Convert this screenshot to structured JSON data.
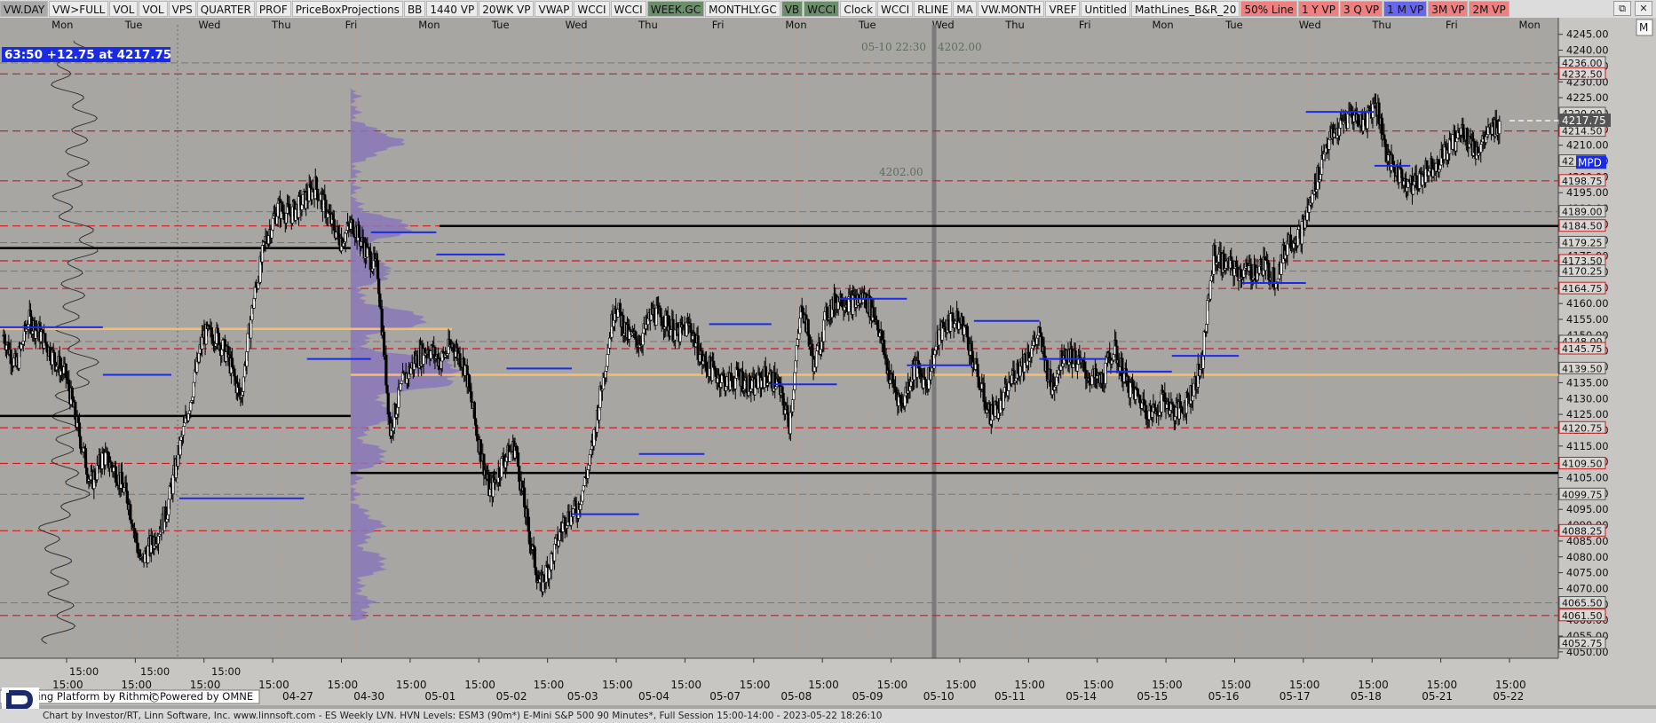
{
  "toolbar": {
    "items": [
      {
        "label": "VW.DAY",
        "bg": "#a9a9a9"
      },
      {
        "label": "VW>FULL",
        "bg": "#ececec"
      },
      {
        "label": "VOL",
        "bg": "#ececec"
      },
      {
        "label": "VOL",
        "bg": "#ececec"
      },
      {
        "label": "VPS",
        "bg": "#ececec"
      },
      {
        "label": "QUARTER",
        "bg": "#ececec"
      },
      {
        "label": "PROF",
        "bg": "#ececec"
      },
      {
        "label": "PriceBoxProjections",
        "bg": "#ececec"
      },
      {
        "label": "BB",
        "bg": "#ececec"
      },
      {
        "label": "1440 VP",
        "bg": "#ececec"
      },
      {
        "label": "20WK VP",
        "bg": "#ececec"
      },
      {
        "label": "VWAP",
        "bg": "#ececec"
      },
      {
        "label": "WCCI",
        "bg": "#ececec"
      },
      {
        "label": "WCCI",
        "bg": "#ececec"
      },
      {
        "label": "WEEK.GC",
        "bg": "#6a8f6a"
      },
      {
        "label": "MONTHLY.GC",
        "bg": "#ececec"
      },
      {
        "label": "VB",
        "bg": "#6a8f6a"
      },
      {
        "label": "WCCI",
        "bg": "#6a8f6a"
      },
      {
        "label": "Clock",
        "bg": "#ececec"
      },
      {
        "label": "WCCI",
        "bg": "#ececec"
      },
      {
        "label": "RLINE",
        "bg": "#ececec"
      },
      {
        "label": "MA",
        "bg": "#ececec"
      },
      {
        "label": "VW.MONTH",
        "bg": "#ececec"
      },
      {
        "label": "VREF",
        "bg": "#ececec"
      },
      {
        "label": "Untitled",
        "bg": "#ececec"
      },
      {
        "label": "MathLines_B&R_20",
        "bg": "#ececec"
      },
      {
        "label": "50% Line",
        "bg": "#f08080"
      },
      {
        "label": "1 Y VP",
        "bg": "#f08080"
      },
      {
        "label": "3 Q VP",
        "bg": "#f08080"
      },
      {
        "label": "1 M VP",
        "bg": "#6666ee"
      },
      {
        "label": "3M VP",
        "bg": "#f08080"
      },
      {
        "label": "2M VP",
        "bg": "#f08080"
      }
    ],
    "window_controls": [
      "⧉",
      "✕"
    ],
    "corner_label": "M"
  },
  "chart_data": {
    "type": "candlestick",
    "ylim": [
      4048,
      4248
    ],
    "yticks": [
      4050,
      4055,
      4060,
      4065,
      4070,
      4075,
      4080,
      4085,
      4090,
      4095,
      4100,
      4105,
      4110,
      4115,
      4120,
      4125,
      4130,
      4135,
      4140,
      4145,
      4150,
      4155,
      4160,
      4165,
      4170,
      4175,
      4180,
      4185,
      4190,
      4195,
      4200,
      4205,
      4210,
      4215,
      4220,
      4225,
      4230,
      4235,
      4240,
      4245
    ],
    "top_day_labels": [
      "Mon",
      "Tue",
      "Wed",
      "Thu",
      "Fri",
      "Mon",
      "Tue",
      "Wed",
      "Thu",
      "Fri",
      "Mon",
      "Tue",
      "Wed",
      "Thu",
      "Fri",
      "Mon",
      "Tue",
      "Wed",
      "Thu",
      "Fri",
      "Mon"
    ],
    "bottom_time_labels": [
      "15:00",
      "15:00",
      "15:00",
      "15:00",
      "15:00",
      "15:00",
      "15:00",
      "15:00",
      "15:00",
      "15:00",
      "15:00",
      "15:00",
      "15:00",
      "15:00",
      "15:00",
      "15:00",
      "15:00",
      "15:00",
      "15:00",
      "15:00",
      "15:00",
      "15:00"
    ],
    "bottom_date_labels": [
      "",
      "",
      "",
      "04-27",
      "04-30",
      "05-01",
      "05-02",
      "05-03",
      "05-04",
      "05-07",
      "05-08",
      "05-09",
      "05-10",
      "05-11",
      "05-14",
      "05-15",
      "05-16",
      "05-17",
      "05-18",
      "05-21",
      "05-22"
    ],
    "lower_time_labels": [
      "15:00",
      "15:00",
      "15:00"
    ],
    "info_badge": "63:50  +12.75 at 4217.75",
    "cursor_readout": {
      "datetime": "05-10 22:30",
      "price": "4202.00"
    },
    "level_label": "4202.00",
    "current_price": "4217.75",
    "mpd_label": "MPD",
    "price_labels": [
      "4236.00",
      "4232.50",
      "4220.00",
      "4214.50",
      "42",
      "4198.75",
      "4189.00",
      "4184.50",
      "4179.25",
      "4173.50",
      "4170.25",
      "4164.75",
      "4148.00",
      "4145.75",
      "4139.50",
      "4120.75",
      "4109.50",
      "4099.75",
      "4088.25",
      "4065.50",
      "4061.50",
      "4052.75"
    ],
    "red_dashed_levels": [
      4232.5,
      4214.5,
      4198.75,
      4184.5,
      4173.5,
      4164.75,
      4145.75,
      4120.75,
      4109.5,
      4088.25,
      4061.5
    ],
    "gray_dashed_levels": [
      4236,
      4189,
      4179.25,
      4170.25,
      4148,
      4099.75,
      4065.5
    ],
    "black_levels": [
      {
        "y": 4184.5,
        "from": 0.282,
        "to": 1.0
      },
      {
        "y": 4177.5,
        "from": 0.0,
        "to": 0.225
      },
      {
        "y": 4124.5,
        "from": 0.0,
        "to": 0.225
      },
      {
        "y": 4106.5,
        "from": 0.225,
        "to": 1.0
      }
    ],
    "orange_levels": [
      {
        "y": 4152,
        "from": 0.0,
        "to": 0.29
      },
      {
        "y": 4137.5,
        "from": 0.225,
        "to": 1.0
      }
    ],
    "blue_segments": [
      {
        "y": 4152.5,
        "from": 0.0,
        "to": 0.066
      },
      {
        "y": 4137.5,
        "from": 0.066,
        "to": 0.11
      },
      {
        "y": 4098.5,
        "from": 0.115,
        "to": 0.195
      },
      {
        "y": 4142.5,
        "from": 0.197,
        "to": 0.238
      },
      {
        "y": 4182.5,
        "from": 0.238,
        "to": 0.28
      },
      {
        "y": 4175.5,
        "from": 0.28,
        "to": 0.324
      },
      {
        "y": 4139.5,
        "from": 0.325,
        "to": 0.367
      },
      {
        "y": 4093.5,
        "from": 0.367,
        "to": 0.41
      },
      {
        "y": 4112.5,
        "from": 0.41,
        "to": 0.452
      },
      {
        "y": 4153.5,
        "from": 0.455,
        "to": 0.495
      },
      {
        "y": 4134.5,
        "from": 0.495,
        "to": 0.537
      },
      {
        "y": 4161.5,
        "from": 0.539,
        "to": 0.582
      },
      {
        "y": 4140.5,
        "from": 0.582,
        "to": 0.624
      },
      {
        "y": 4154.5,
        "from": 0.625,
        "to": 0.667
      },
      {
        "y": 4142.5,
        "from": 0.667,
        "to": 0.71
      },
      {
        "y": 4138.5,
        "from": 0.71,
        "to": 0.752
      },
      {
        "y": 4143.5,
        "from": 0.752,
        "to": 0.795
      },
      {
        "y": 4166.5,
        "from": 0.797,
        "to": 0.838
      },
      {
        "y": 4220.5,
        "from": 0.838,
        "to": 0.882
      },
      {
        "y": 4203.5,
        "from": 0.882,
        "to": 0.905
      }
    ],
    "candles": {
      "anchors": [
        4150,
        4140,
        4155,
        4150,
        4143,
        4137,
        4120,
        4103,
        4112,
        4107,
        4098,
        4078,
        4085,
        4093,
        4112,
        4130,
        4150,
        4150,
        4143,
        4130,
        4160,
        4180,
        4190,
        4188,
        4192,
        4197,
        4188,
        4180,
        4185,
        4177,
        4170,
        4120,
        4135,
        4142,
        4146,
        4142,
        4147,
        4140,
        4118,
        4100,
        4110,
        4115,
        4090,
        4070,
        4080,
        4092,
        4095,
        4110,
        4135,
        4160,
        4150,
        4148,
        4157,
        4155,
        4150,
        4153,
        4142,
        4138,
        4135,
        4137,
        4133,
        4137,
        4135,
        4122,
        4160,
        4140,
        4157,
        4162,
        4160,
        4162,
        4155,
        4137,
        4128,
        4140,
        4135,
        4150,
        4155,
        4153,
        4138,
        4125,
        4128,
        4138,
        4143,
        4150,
        4133,
        4145,
        4142,
        4137,
        4135,
        4146,
        4135,
        4130,
        4125,
        4130,
        4125,
        4130,
        4140,
        4175,
        4172,
        4170,
        4170,
        4172,
        4168,
        4180,
        4182,
        4195,
        4210,
        4215,
        4220,
        4217,
        4224,
        4205,
        4200,
        4197,
        4202,
        4205,
        4210,
        4215,
        4208,
        4213,
        4217.75
      ],
      "volatility": 7
    },
    "volume_profile": {
      "start_x": 0.225,
      "max_width": 0.066,
      "peaks": [
        {
          "y": 4211,
          "w": 0.45
        },
        {
          "y": 4184,
          "w": 0.55
        },
        {
          "y": 4170,
          "w": 0.35
        },
        {
          "y": 4155,
          "w": 0.7
        },
        {
          "y": 4140,
          "w": 1.0
        },
        {
          "y": 4136,
          "w": 0.9
        },
        {
          "y": 4125,
          "w": 0.4
        },
        {
          "y": 4112,
          "w": 0.3
        },
        {
          "y": 4090,
          "w": 0.25
        },
        {
          "y": 4078,
          "w": 0.3
        },
        {
          "y": 4065,
          "w": 0.15
        }
      ],
      "top": 4228,
      "bottom": 4060,
      "color": "#8877b8"
    },
    "colors": {
      "background": "#a8a6a3",
      "red_dashed": "#c81e1e",
      "gray_dashed": "#777777",
      "black_line": "#000000",
      "orange_line": "#f4c070",
      "blue_line": "#1a2be8",
      "candle": "#000000",
      "current_price_bg": "#555555",
      "mpd_bg": "#1a2be8",
      "badge_bg": "#1a2be8"
    }
  },
  "footer": {
    "trading_platform": "Trading Platform by Rithmic",
    "powered_by": "Powered by OMNE",
    "status_line": "Chart by Investor/RT, Linn Software, Inc. www.linnsoft.com - ES Weekly LVN. HVN Levels: ESM3 (90m*) E-Mini S&P 500 90 Minutes*, Full Session 15:00-14:00 - 2023-05-22 18:26:10"
  }
}
